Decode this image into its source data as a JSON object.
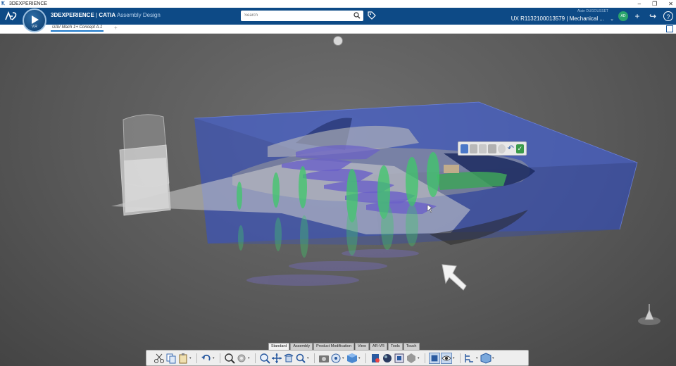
{
  "os_window": {
    "title": "3DEXPERIENCE",
    "controls": [
      "–",
      "❐",
      "✕"
    ]
  },
  "topbar": {
    "brand_prefix": "3DEXPERIENCE",
    "brand_separator": " | ",
    "brand_product": "CATIA",
    "brand_app": " Assembly Design",
    "search_placeholder": "Search",
    "user_name": "Alain DUGOUSSET",
    "context": "UX R1132100013579 | Mechanical ...",
    "avatar_initials": "AD",
    "compass_label": "V,R"
  },
  "tabs": {
    "active_doc": "UAV Mach 1+ Concept A.1",
    "add": "+"
  },
  "action_tabs": [
    "Standard",
    "Assembly",
    "Product Modification",
    "View",
    "AR-VR",
    "Tools",
    "Touch"
  ],
  "active_action_tab": "View",
  "icons": {
    "toolbar": [
      "cut-icon",
      "copy-icon",
      "paste-icon",
      "undo-icon",
      "fit-all-icon",
      "settings-icon",
      "zoom-icon",
      "pan-icon",
      "rotate-icon",
      "magnify-icon",
      "capture-icon",
      "view-mode-icon",
      "cube-view-icon",
      "render-icon",
      "lighting-icon",
      "material-icon",
      "hide-show-icon",
      "tree-icon",
      "product-icon"
    ]
  },
  "colors": {
    "brand_blue": "#0d4a86",
    "accent_green": "#2aa36c",
    "box_blue": "#3a55c8"
  }
}
